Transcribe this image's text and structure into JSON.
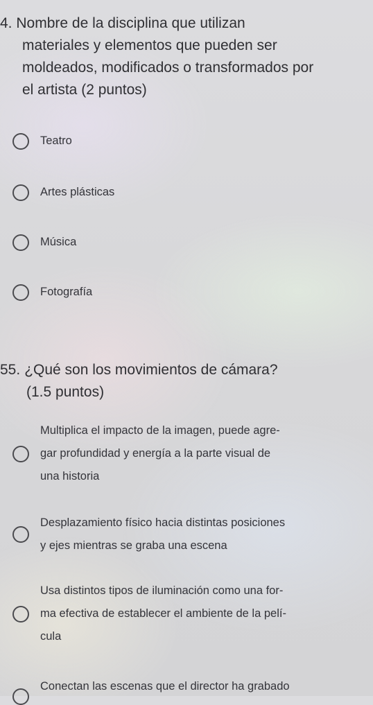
{
  "questions": [
    {
      "number": "4.",
      "title_lines": [
        "Nombre de la disciplina que utilizan",
        "materiales y elementos que pueden ser",
        "moldeados, modificados o transformados por",
        "el artista (2 puntos)"
      ],
      "options": [
        {
          "label": "Teatro"
        },
        {
          "label": "Artes plásticas"
        },
        {
          "label": "Música"
        },
        {
          "label": "Fotografía"
        }
      ]
    },
    {
      "number": "55.",
      "title": "¿Qué son los movimientos de cámara?",
      "points": "(1.5 puntos)",
      "options": [
        {
          "lines": [
            "Multiplica el impacto de la imagen, puede agre-",
            "gar profundidad y energía a la parte visual de",
            "una historia"
          ]
        },
        {
          "lines": [
            "Desplazamiento físico hacia distintas posiciones",
            "y ejes mientras se graba una escena"
          ]
        },
        {
          "lines": [
            "Usa distintos tipos de iluminación como una for-",
            "ma efectiva de establecer el ambiente de la pelí-",
            "cula"
          ]
        },
        {
          "lines": [
            "Conectan las escenas que el director ha grabado"
          ]
        }
      ]
    }
  ]
}
